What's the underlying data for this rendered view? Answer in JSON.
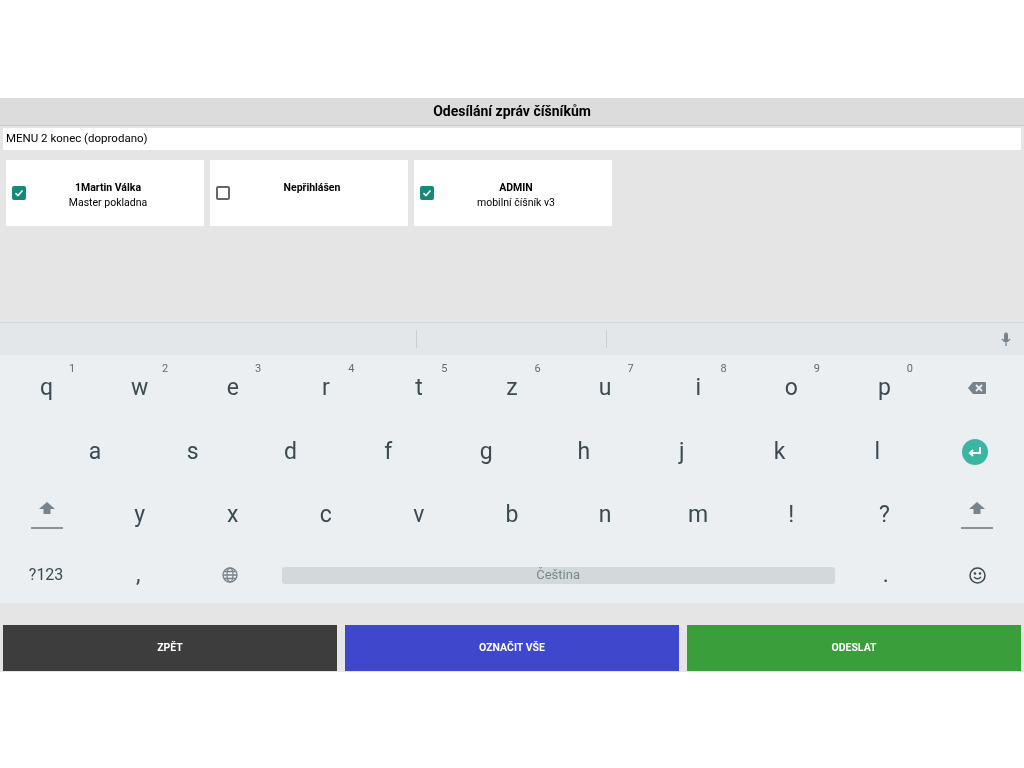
{
  "title": "Odesílání zpráv číšníkům",
  "message": {
    "value": "MENU 2 konec (doprodano)"
  },
  "waiters": [
    {
      "name": "1Martin Válka",
      "device": "Master pokladna",
      "checked": true
    },
    {
      "name": "Nepřihlášen",
      "checked": false
    },
    {
      "name": "ADMIN",
      "device": "mobilní číšník v3",
      "checked": true
    }
  ],
  "keyboard": {
    "rows": [
      {
        "keys": [
          {
            "kind": "char",
            "label": "q",
            "hint": "1"
          },
          {
            "kind": "char",
            "label": "w",
            "hint": "2"
          },
          {
            "kind": "char",
            "label": "e",
            "hint": "3"
          },
          {
            "kind": "char",
            "label": "r",
            "hint": "4"
          },
          {
            "kind": "char",
            "label": "t",
            "hint": "5"
          },
          {
            "kind": "char",
            "label": "z",
            "hint": "6"
          },
          {
            "kind": "char",
            "label": "u",
            "hint": "7"
          },
          {
            "kind": "char",
            "label": "i",
            "hint": "8"
          },
          {
            "kind": "char",
            "label": "o",
            "hint": "9"
          },
          {
            "kind": "char",
            "label": "p",
            "hint": "0"
          },
          {
            "kind": "backspace"
          }
        ]
      },
      {
        "keys": [
          {
            "kind": "char",
            "label": "a"
          },
          {
            "kind": "char",
            "label": "s"
          },
          {
            "kind": "char",
            "label": "d"
          },
          {
            "kind": "char",
            "label": "f"
          },
          {
            "kind": "char",
            "label": "g"
          },
          {
            "kind": "char",
            "label": "h"
          },
          {
            "kind": "char",
            "label": "j"
          },
          {
            "kind": "char",
            "label": "k"
          },
          {
            "kind": "char",
            "label": "l"
          },
          {
            "kind": "enter"
          }
        ]
      },
      {
        "keys": [
          {
            "kind": "shift"
          },
          {
            "kind": "char",
            "label": "y"
          },
          {
            "kind": "char",
            "label": "x"
          },
          {
            "kind": "char",
            "label": "c"
          },
          {
            "kind": "char",
            "label": "v"
          },
          {
            "kind": "char",
            "label": "b"
          },
          {
            "kind": "char",
            "label": "n"
          },
          {
            "kind": "char",
            "label": "m"
          },
          {
            "kind": "char",
            "label": "!"
          },
          {
            "kind": "char",
            "label": "?"
          },
          {
            "kind": "shift"
          }
        ]
      },
      {
        "keys": [
          {
            "kind": "mode",
            "label": "?123"
          },
          {
            "kind": "char",
            "label": ","
          },
          {
            "kind": "globe"
          },
          {
            "kind": "space",
            "label": "Čeština"
          },
          {
            "kind": "char",
            "label": "."
          },
          {
            "kind": "emoji"
          }
        ]
      }
    ]
  },
  "buttons": [
    {
      "label": "ZPĚT",
      "kind": "back"
    },
    {
      "label": "OZNAČIT VŠE",
      "kind": "select_all"
    },
    {
      "label": "ODESLAT",
      "kind": "send"
    }
  ]
}
